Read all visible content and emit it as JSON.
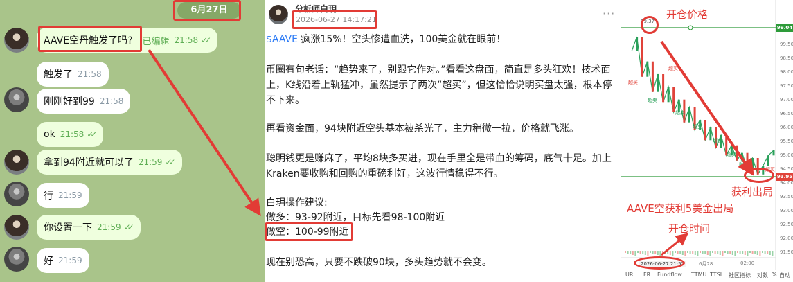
{
  "chat": {
    "date_label": "6月27日",
    "messages": [
      {
        "text": "AAVE空丹触发了吗?",
        "edited": "已编辑",
        "time": "21:58",
        "outgoing": true
      },
      {
        "text": "触发了",
        "time": "21:58",
        "outgoing": false
      },
      {
        "text": "刚刚好到99",
        "time": "21:58",
        "outgoing": false
      },
      {
        "text": "ok",
        "time": "21:58",
        "outgoing": true
      },
      {
        "text": "拿到94附近就可以了",
        "time": "21:59",
        "outgoing": true
      },
      {
        "text": "行",
        "time": "21:59",
        "outgoing": false
      },
      {
        "text": "你设置一下",
        "time": "21:59",
        "outgoing": true
      },
      {
        "text": "好",
        "time": "21:59",
        "outgoing": false
      }
    ],
    "ticks": "✓✓"
  },
  "post": {
    "author": "分析师白玥",
    "timestamp": "2026-06-27 14:17:21",
    "more_icon": "···",
    "ticker": "$AAVE",
    "lead": " 疯涨15%！空头惨遭血洗，100美金就在眼前！",
    "p2": "币圈有句老话：“趋势来了，别跟它作对。”看看这盘面，简直是多头狂欢！技术面上，K线沿着上轨猛冲，虽然提示了两次“超买”，但这恰恰说明买盘太强，根本停不下来。",
    "p3": "再看资金面，94块附近空头基本被杀光了，主力稍微一拉，价格就飞涨。",
    "p4": "聪明钱更是赚麻了，平均8块多买进，现在手里全是带血的筹码，底气十足。加上Kraken要收购和回购的重磅利好，这波行情稳得不行。",
    "p5_title": "白玥操作建议:",
    "p5_long": "做多：93-92附近，目标先看98-100附近",
    "p5_short": "做空：100-99附近",
    "p6": "现在别恐高，只要不跌破90块，多头趋势就不会变。"
  },
  "chart_data": {
    "type": "line",
    "y_ticks": [
      "99.50",
      "98.50",
      "98.00",
      "97.50",
      "97.00",
      "96.50",
      "96.00",
      "95.50",
      "95.00",
      "94.50",
      "94.00",
      "93.50",
      "93.00",
      "92.50",
      "92.00",
      "91.50"
    ],
    "entry_price": "99.04",
    "exit_price": "93.95",
    "entry_marker": "99.37",
    "x_ticks": [
      "6月28",
      "02:00"
    ],
    "cursor_time": "2026-06-27 21:57",
    "ylim": [
      91.0,
      100.0
    ],
    "close": [
      98.8,
      99.37,
      97.8,
      98.4,
      97.2,
      97.9,
      96.8,
      97.4,
      96.4,
      96.9,
      96.0,
      96.6,
      95.7,
      96.1,
      95.3,
      95.8,
      95.0,
      95.5,
      94.7,
      95.1,
      94.5,
      94.8,
      94.2,
      94.6,
      93.95,
      94.3,
      94.7,
      94.9
    ],
    "signals": [
      {
        "label": "超买",
        "kind": "sell"
      },
      {
        "label": "超卖",
        "kind": "buy"
      },
      {
        "label": "超买",
        "kind": "sell"
      },
      {
        "label": "超卖",
        "kind": "buy"
      },
      {
        "label": "超卖",
        "kind": "buy"
      },
      {
        "label": "超卖",
        "kind": "buy"
      },
      {
        "label": "超卖",
        "kind": "buy"
      },
      {
        "label": "超卖",
        "kind": "buy"
      },
      {
        "label": "超买",
        "kind": "sell"
      }
    ],
    "bottom_tabs": [
      "UR",
      "FR",
      "Fundflow",
      "TTMU",
      "TTSI",
      "社区指标",
      "对数",
      "%",
      "自动"
    ]
  },
  "annotations": {
    "entry_price_label": "开仓价格",
    "exit_label": "获利出局",
    "profit_label": "AAVE空获利5美金出局",
    "entry_time_label": "开仓时间"
  },
  "colors": {
    "annotation": "#e23b35",
    "chat_bg": "#a9c48a",
    "outgoing_bubble": "#efffde",
    "ticker": "#2e7cf6",
    "green_line": "#2e9b3a"
  }
}
